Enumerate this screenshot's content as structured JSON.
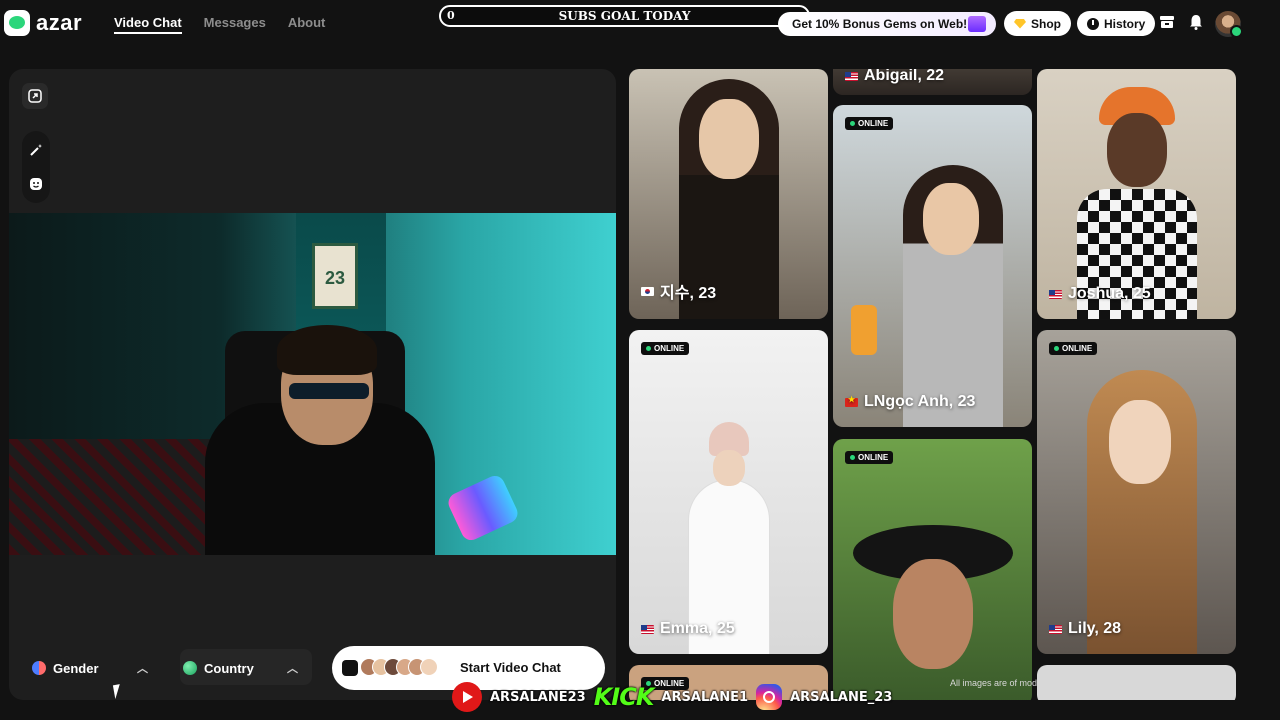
{
  "app": {
    "logo_text": "azar"
  },
  "nav": {
    "items": [
      {
        "label": "Video Chat",
        "active": true
      },
      {
        "label": "Messages",
        "active": false
      },
      {
        "label": "About",
        "active": false
      }
    ]
  },
  "subs_goal": {
    "label": "SUBS GOAL TODAY",
    "count": "0"
  },
  "promo": {
    "label": "Get 10% Bonus Gems on Web!"
  },
  "header_buttons": {
    "shop": "Shop",
    "history": "History"
  },
  "icons": {
    "store": "store-icon",
    "bell": "bell-icon"
  },
  "camera_feed": {
    "jersey_number": "23"
  },
  "filters": {
    "gender": "Gender",
    "country": "Country"
  },
  "start": {
    "label": "Start Video Chat"
  },
  "cards": [
    {
      "name": "지수, 23",
      "flag": "kr",
      "online": false
    },
    {
      "name": "Abigail, 22",
      "flag": "us",
      "online": false
    },
    {
      "name": "LNgọc Anh, 23",
      "flag": "vn",
      "online": true
    },
    {
      "name": "Joshua, 25",
      "flag": "us",
      "online": false
    },
    {
      "name": "Emma, 25",
      "flag": "us",
      "online": true
    },
    {
      "name": "",
      "flag": "",
      "online": true
    },
    {
      "name": "Lily, 28",
      "flag": "us",
      "online": true
    }
  ],
  "badge_label": "ONLINE",
  "disclaimer": "All images are of models and are used for illustrative purposes only.",
  "social": {
    "youtube": "ARSALANE23",
    "kick_logo": "KICK",
    "kick": "ARSALANE1",
    "instagram": "ARSALANE_23"
  },
  "colors": {
    "accent": "#2bd67b",
    "background": "#121212",
    "panel": "#1e1e1e"
  }
}
